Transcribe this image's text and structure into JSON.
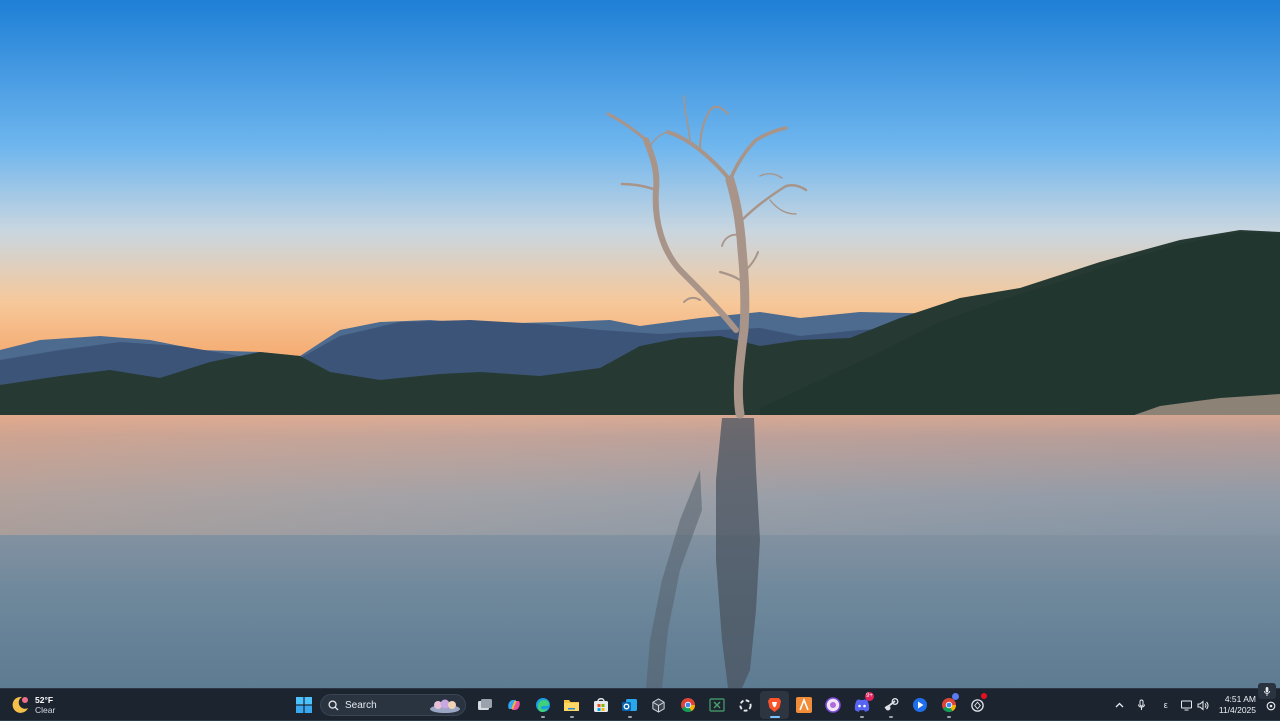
{
  "desktop": {
    "wallpaper": "lone-tree-lake-sunset"
  },
  "taskbar": {
    "weather": {
      "temperature": "52°F",
      "condition": "Clear",
      "icon": "moon-weather-icon"
    },
    "search": {
      "label": "Search"
    },
    "apps": [
      {
        "name": "start",
        "icon": "windows-start-icon"
      },
      {
        "name": "task-view",
        "icon": "task-view-icon"
      },
      {
        "name": "copilot",
        "icon": "copilot-icon"
      },
      {
        "name": "edge",
        "icon": "edge-icon"
      },
      {
        "name": "file-explorer",
        "icon": "folder-icon"
      },
      {
        "name": "microsoft-store",
        "icon": "store-icon"
      },
      {
        "name": "outlook",
        "icon": "outlook-icon"
      },
      {
        "name": "unity-hub",
        "icon": "cube-icon"
      },
      {
        "name": "chrome",
        "icon": "chrome-icon"
      },
      {
        "name": "excel-like",
        "icon": "spreadsheet-icon"
      },
      {
        "name": "loading-app",
        "icon": "spinner-icon"
      },
      {
        "name": "brave",
        "icon": "brave-icon"
      },
      {
        "name": "app-a",
        "icon": "orange-a-icon"
      },
      {
        "name": "app-circle",
        "icon": "purple-circle-icon"
      },
      {
        "name": "discord",
        "icon": "discord-icon",
        "badge": "9+"
      },
      {
        "name": "steam",
        "icon": "steam-icon"
      },
      {
        "name": "app-blue",
        "icon": "blue-play-icon"
      },
      {
        "name": "chrome-profile",
        "icon": "chrome-icon"
      },
      {
        "name": "chatgpt",
        "icon": "openai-icon"
      }
    ],
    "tray": {
      "language": "ε",
      "time": "4:51 AM",
      "date": "11/4/2025"
    },
    "colors": {
      "taskbar_bg": "#1c2430",
      "accent": "#7cc4ff"
    }
  }
}
